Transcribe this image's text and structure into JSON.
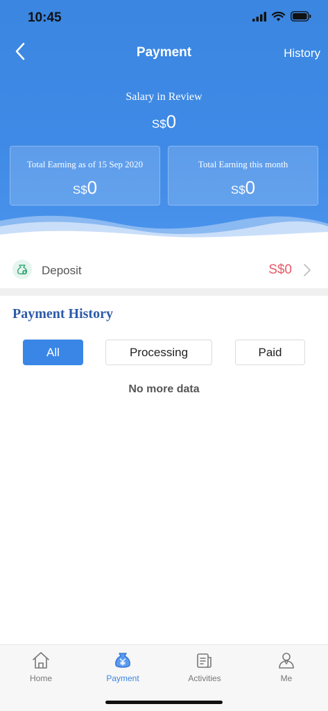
{
  "status_bar": {
    "time": "10:45"
  },
  "nav": {
    "title": "Payment",
    "history_label": "History"
  },
  "summary": {
    "salary_label": "Salary in Review",
    "currency": "S$",
    "salary_value": "0",
    "cards": [
      {
        "label": "Total Earning as of 15 Sep 2020",
        "currency": "S$",
        "value": "0"
      },
      {
        "label": "Total Earning this month",
        "currency": "S$",
        "value": "0"
      }
    ]
  },
  "deposit": {
    "label": "Deposit",
    "amount": "S$0"
  },
  "payment_history": {
    "title": "Payment History",
    "filters": [
      {
        "label": "All",
        "selected": true
      },
      {
        "label": "Processing",
        "selected": false
      },
      {
        "label": "Paid",
        "selected": false
      }
    ],
    "empty_text": "No more data"
  },
  "tabbar": {
    "items": [
      {
        "label": "Home",
        "icon": "home-icon",
        "active": false
      },
      {
        "label": "Payment",
        "icon": "money-bag-icon",
        "active": true
      },
      {
        "label": "Activities",
        "icon": "activities-icon",
        "active": false
      },
      {
        "label": "Me",
        "icon": "user-icon",
        "active": false
      }
    ]
  },
  "colors": {
    "primary": "#3a86e6",
    "deposit_amount": "#e8596b",
    "history_title": "#2d5aa8"
  }
}
